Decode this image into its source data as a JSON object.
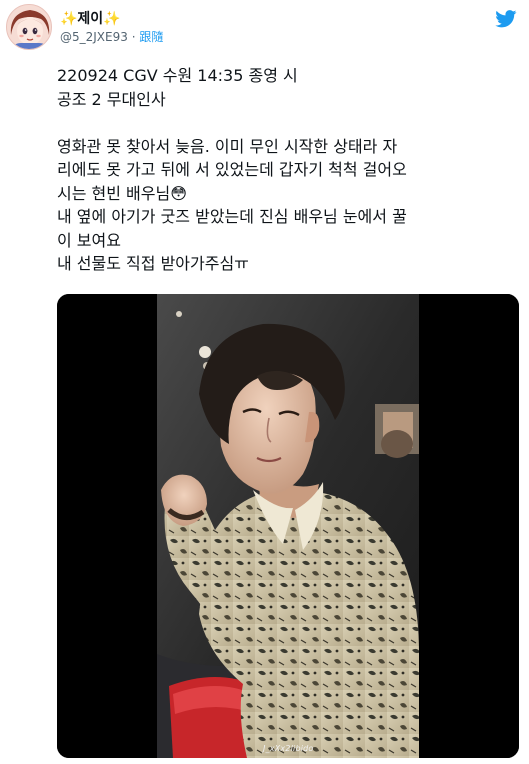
{
  "user": {
    "display_name": "✨제이✨",
    "handle": "@5_2JXE93",
    "separator": "·",
    "follow_label": "跟隨",
    "avatar_icon": "anime-girl-avatar-icon"
  },
  "brand": {
    "icon": "twitter-bird-icon",
    "color": "#1d9bf0"
  },
  "tweet": {
    "text": "220924 CGV 수원 14:35 종영 시\n공조 2 무대인사\n\n영화관 못 찾아서 늦음. 이미 무인 시작한 상태라 자\n리에도 못 가고 뒤에 서 있었는데 갑자기 척척 걸어오\n시는 현빈 배우님😳\n내 옆에 아기가 굿즈 받았는데 진심 배우님 눈에서 꿀\n이 보여요\n내 선물도 직접 받아가주심ㅠ"
  },
  "media": {
    "type": "video",
    "watermark": "J_xXx2libido"
  }
}
